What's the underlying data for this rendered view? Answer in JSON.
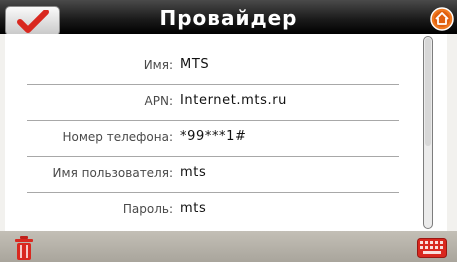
{
  "header": {
    "title": "Провайдер",
    "ok_icon": "checkmark-icon",
    "home_icon": "home-icon"
  },
  "fields": [
    {
      "label": "Имя:",
      "value": "MTS"
    },
    {
      "label": "APN:",
      "value": "Internet.mts.ru"
    },
    {
      "label": "Номер телефона:",
      "value": "*99***1#"
    },
    {
      "label": "Имя пользователя:",
      "value": "mts"
    },
    {
      "label": "Пароль:",
      "value": "mts"
    }
  ],
  "scrollbar": {
    "position_fraction": 0.0,
    "visible_fraction": 0.55
  },
  "toolbar": {
    "delete_icon": "trash-icon",
    "keyboard_icon": "keyboard-icon"
  },
  "colors": {
    "accent_red": "#d9281f",
    "header_bg": "#000000",
    "toolbar_bg": "#b5b1a8",
    "home_orange": "#f07a22"
  }
}
